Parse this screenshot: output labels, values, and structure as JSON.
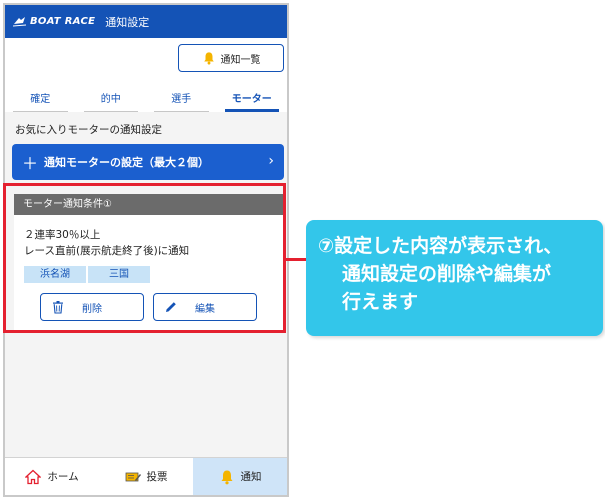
{
  "app": {
    "brand": "BOAT RACE",
    "title": "通知設定"
  },
  "header": {
    "notification_list_label": "通知一覧"
  },
  "tabs": [
    {
      "label": "確定",
      "active": false
    },
    {
      "label": "的中",
      "active": false
    },
    {
      "label": "選手",
      "active": false
    },
    {
      "label": "モーター",
      "active": true
    }
  ],
  "section": {
    "title": "お気に入りモーターの通知設定"
  },
  "setting_button": {
    "plus": "＋",
    "label": "通知モーターの設定（最大２個）",
    "chevron": "›"
  },
  "card": {
    "title": "モーター通知条件①",
    "condition1": "２連率30％以上",
    "condition2": "レース直前(展示航走終了後)に通知",
    "tags": [
      "浜名湖",
      "三国"
    ],
    "delete_label": "削除",
    "edit_label": "編集"
  },
  "bottom_nav": [
    {
      "label": "ホーム",
      "icon": "home-icon",
      "active": false
    },
    {
      "label": "投票",
      "icon": "ticket-icon",
      "active": false
    },
    {
      "label": "通知",
      "icon": "bell-icon",
      "active": true
    }
  ],
  "callout": {
    "line1": "⑦設定した内容が表示され、",
    "line2": "通知設定の削除や編集が",
    "line3": "行えます"
  },
  "colors": {
    "brand_blue": "#1453b6",
    "button_blue": "#1b5fcf",
    "highlight_red": "#e4202f",
    "callout_cyan": "#33c6ea",
    "tag_bg": "#c8e3f7"
  }
}
